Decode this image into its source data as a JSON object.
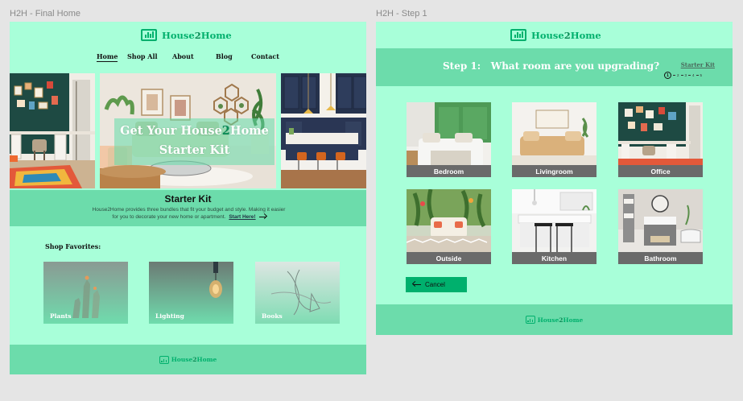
{
  "frames": {
    "home_label": "H2H - Final Home",
    "step_label": "H2H - Step 1"
  },
  "brand": {
    "name_a": "House",
    "name_2": "2",
    "name_b": "Home",
    "accent": "#00b06d",
    "background": "#a8ffd9",
    "band": "#6cdcab"
  },
  "nav": {
    "home": "Home",
    "shop_all": "Shop All",
    "about": "About",
    "blog": "Blog",
    "contact": "Contact"
  },
  "hero": {
    "line1_a": "Get Your House",
    "line1_2": "2",
    "line1_b": "Home",
    "line2": "Starter Kit"
  },
  "kit": {
    "title": "Starter Kit",
    "desc_line1": "House2Home provides three bundles that fit your budget and style.  Making it easier",
    "desc_line2": "for you to decorate your new home or apartment.",
    "link": "Start Here!"
  },
  "favorites": {
    "title": "Shop Favorites:",
    "items": [
      "Plants",
      "Lighting",
      "Books"
    ]
  },
  "step": {
    "title": "Step 1:   What room are you upgrading?",
    "starter_link": "Starter Kit",
    "steps": [
      "1",
      "2",
      "3",
      "4",
      "5"
    ],
    "rooms": [
      "Bedroom",
      "Livingroom",
      "Office",
      "Outside",
      "Kitchen",
      "Bathroom"
    ],
    "cancel": "Cancel"
  },
  "icons": [
    "house2home-logo-icon",
    "arrow-right-icon",
    "arrow-left-icon"
  ]
}
